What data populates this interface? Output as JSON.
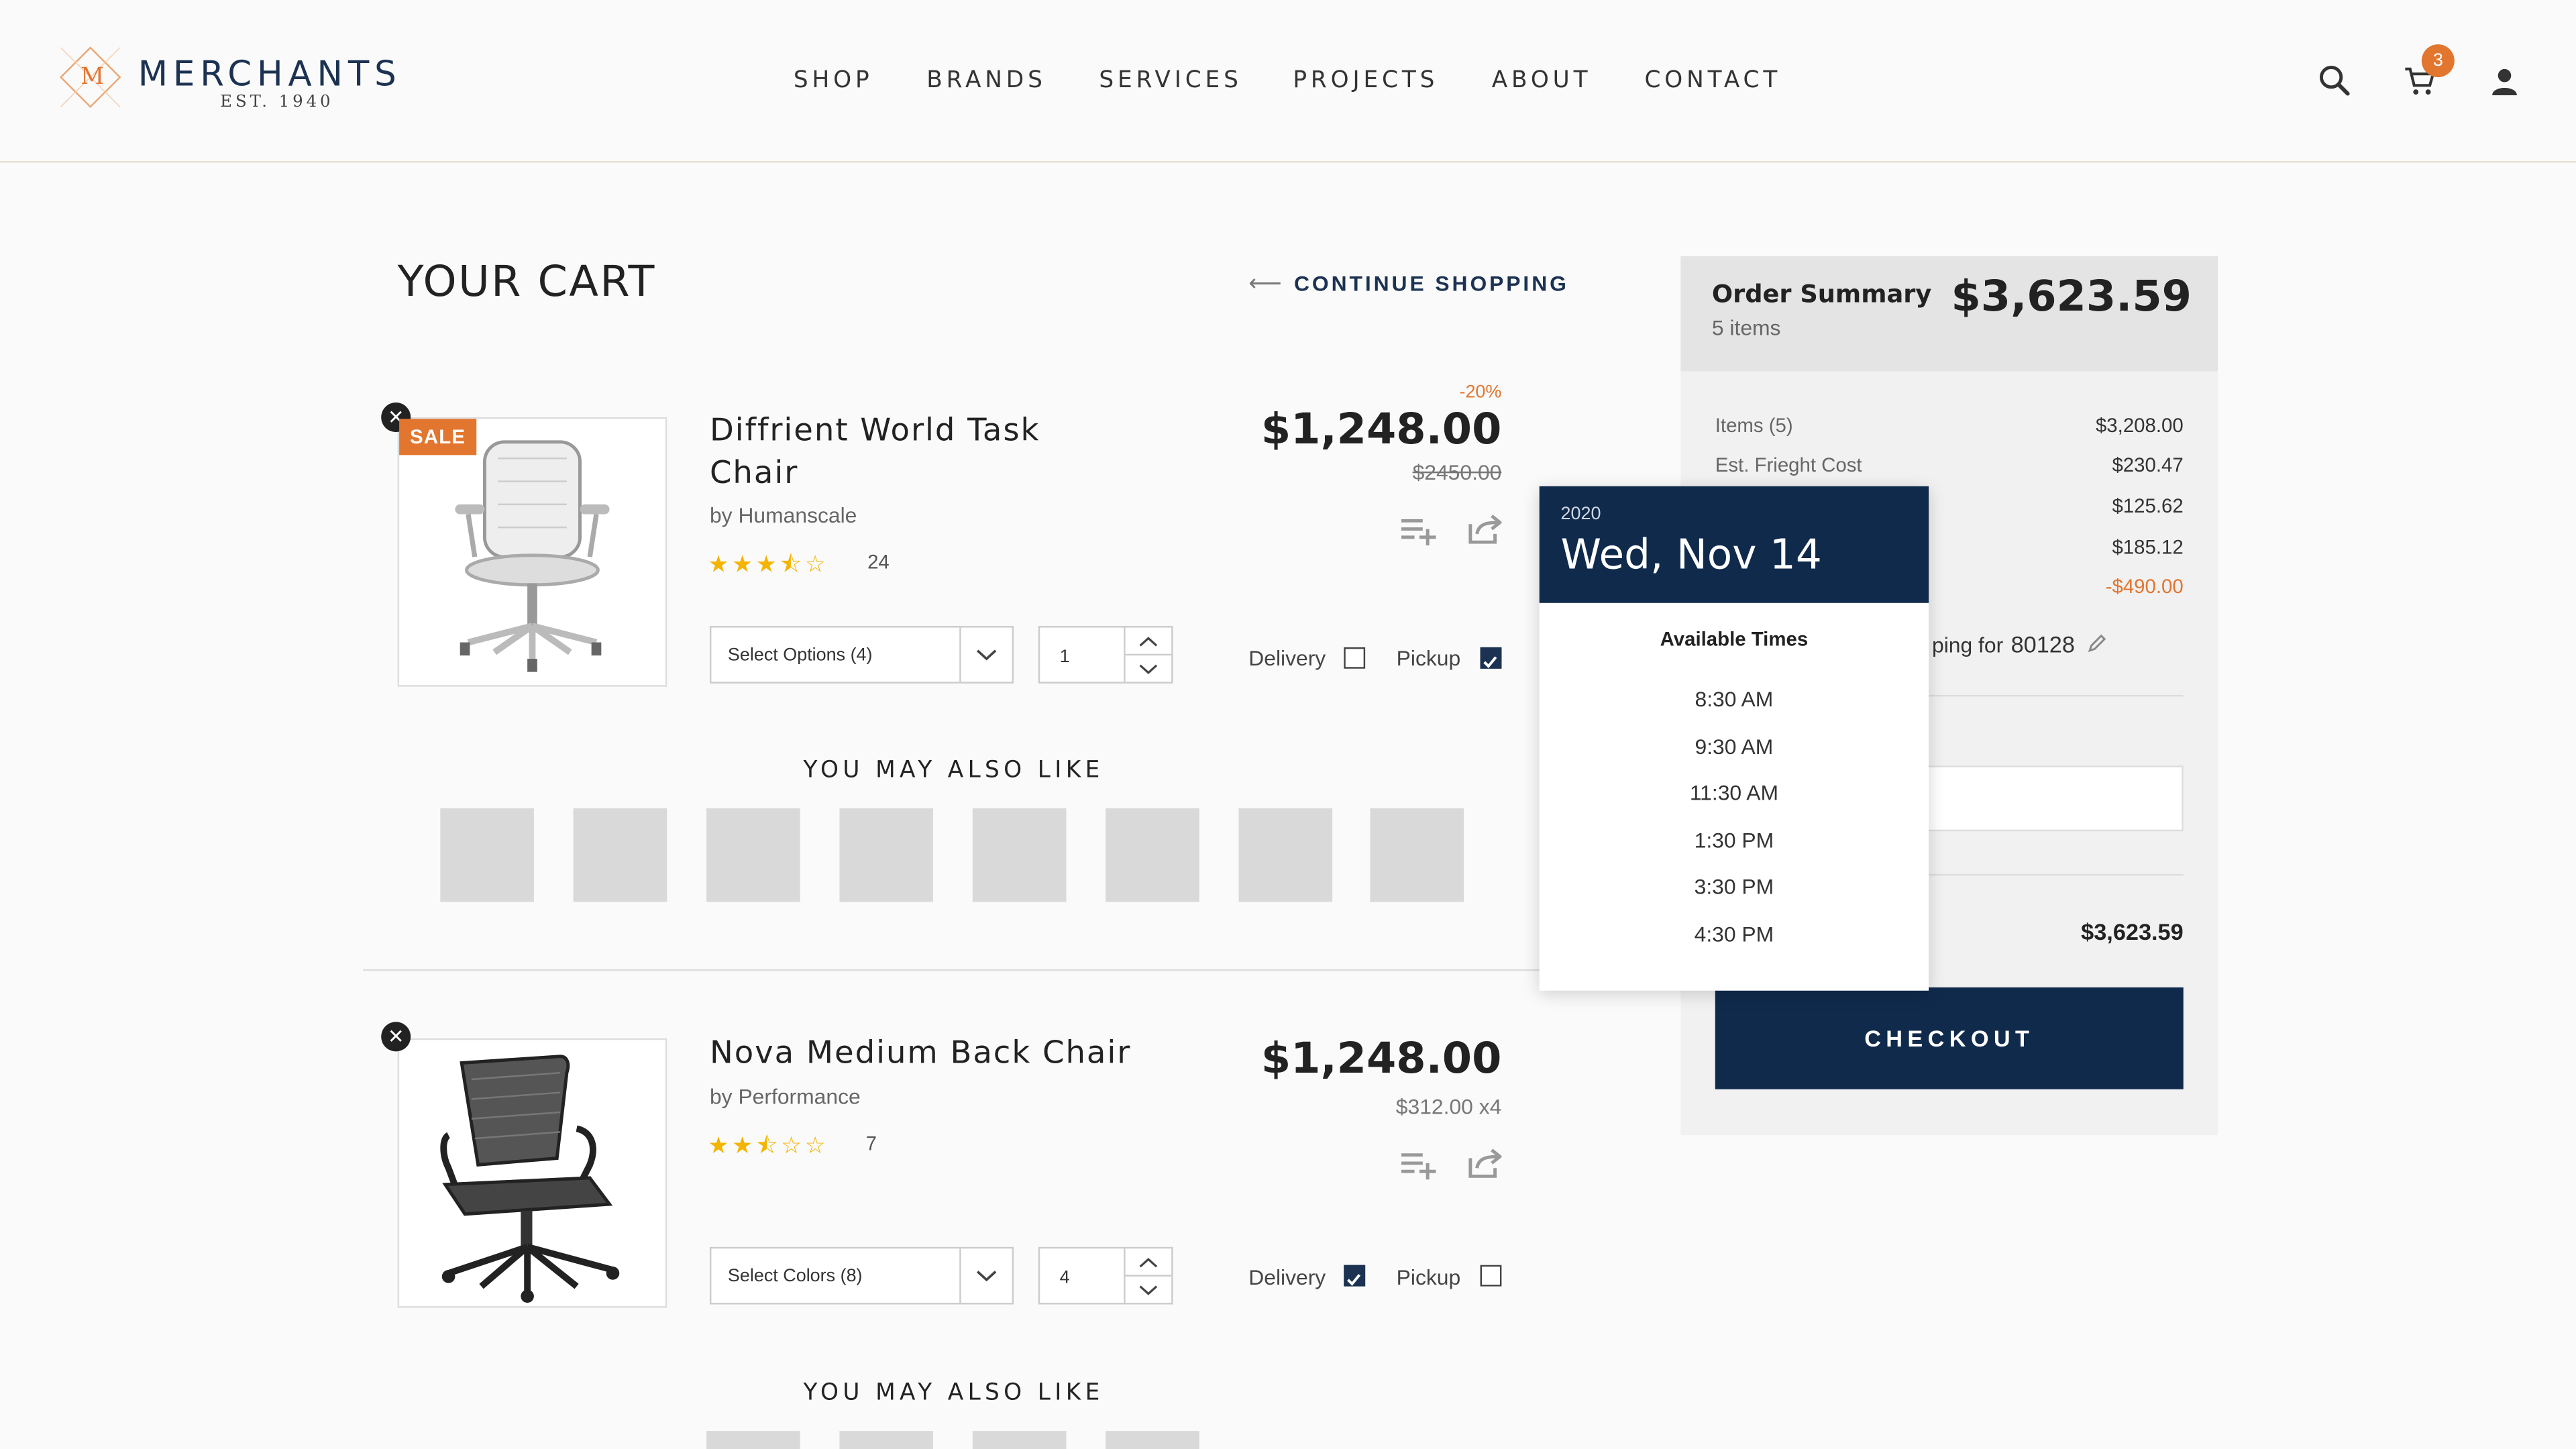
{
  "header": {
    "logo_letter": "M",
    "logo_name": "MERCHANTS",
    "logo_est": "EST. 1940",
    "nav": [
      "SHOP",
      "BRANDS",
      "SERVICES",
      "PROJECTS",
      "ABOUT",
      "CONTACT"
    ],
    "cart_count": "3"
  },
  "cart": {
    "title": "YOUR CART",
    "continue_label": "CONTINUE SHOPPING",
    "items": [
      {
        "sale_badge": "SALE",
        "name_line1": "Diffrient World Task",
        "name_line2": "Chair",
        "brand": "by Humanscale",
        "stars": "★★★⯪☆",
        "rating_count": "24",
        "discount": "-20%",
        "price": "$1,248.00",
        "original_price": "$2450.00",
        "options_label": "Select Options (4)",
        "qty": "1",
        "delivery_label": "Delivery",
        "pickup_label": "Pickup",
        "delivery_checked": false,
        "pickup_checked": true
      },
      {
        "name_line1": "Nova Medium Back Chair",
        "brand": "by Performance",
        "stars": "★★⯪☆☆",
        "rating_count": "7",
        "price": "$1,248.00",
        "unit_price": "$312.00  x4",
        "options_label": "Select Colors (8)",
        "qty": "4",
        "delivery_label": "Delivery",
        "pickup_label": "Pickup",
        "delivery_checked": true,
        "pickup_checked": false
      }
    ],
    "also_like_label": "YOU MAY ALSO LIKE"
  },
  "summary": {
    "title": "Order Summary",
    "items_count": "5 items",
    "total": "$3,623.59",
    "rows": [
      {
        "label": "Items (5)",
        "value": "$3,208.00"
      },
      {
        "label": "Est. Frieght Cost",
        "value": "$230.47"
      },
      {
        "label": "",
        "value": "$125.62"
      },
      {
        "label": "",
        "value": "$185.12"
      },
      {
        "label": "",
        "value": "-$490.00"
      }
    ],
    "shipping_text": "ping for",
    "zip": "80128",
    "grand_total": "$3,623.59",
    "checkout_label": "CHECKOUT"
  },
  "date_popup": {
    "year": "2020",
    "date": "Wed, Nov 14",
    "available_label": "Available Times",
    "times": [
      "8:30 AM",
      "9:30 AM",
      "11:30 AM",
      "1:30 PM",
      "3:30 PM",
      "4:30 PM"
    ]
  },
  "colors": {
    "navy": "#102a4c",
    "accent_orange": "#e2762f",
    "star_gold": "#f4b400"
  }
}
